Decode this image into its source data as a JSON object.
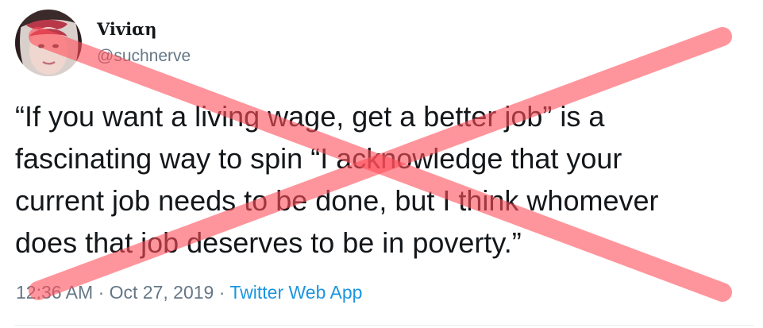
{
  "author": {
    "display_name": "Viviαη",
    "handle": "@suchnerve",
    "avatar_icon": "profile-photo-avatar"
  },
  "tweet": {
    "lines": [
      "“If you want a living wage, get a better job” is a",
      "fascinating way to spin “I acknowledge that your",
      "current job needs to be done, but I think whomever",
      "does that job deserves to be in poverty.”"
    ]
  },
  "meta": {
    "time": "12:36 AM",
    "separator": "·",
    "date": "Oct 27, 2019",
    "source": "Twitter Web App"
  },
  "overlay": {
    "icon": "red-x-cross-out-icon",
    "color": "#ff4f5a"
  },
  "colors": {
    "text": "#14171a",
    "secondary": "#657786",
    "link": "#1b95e0"
  }
}
